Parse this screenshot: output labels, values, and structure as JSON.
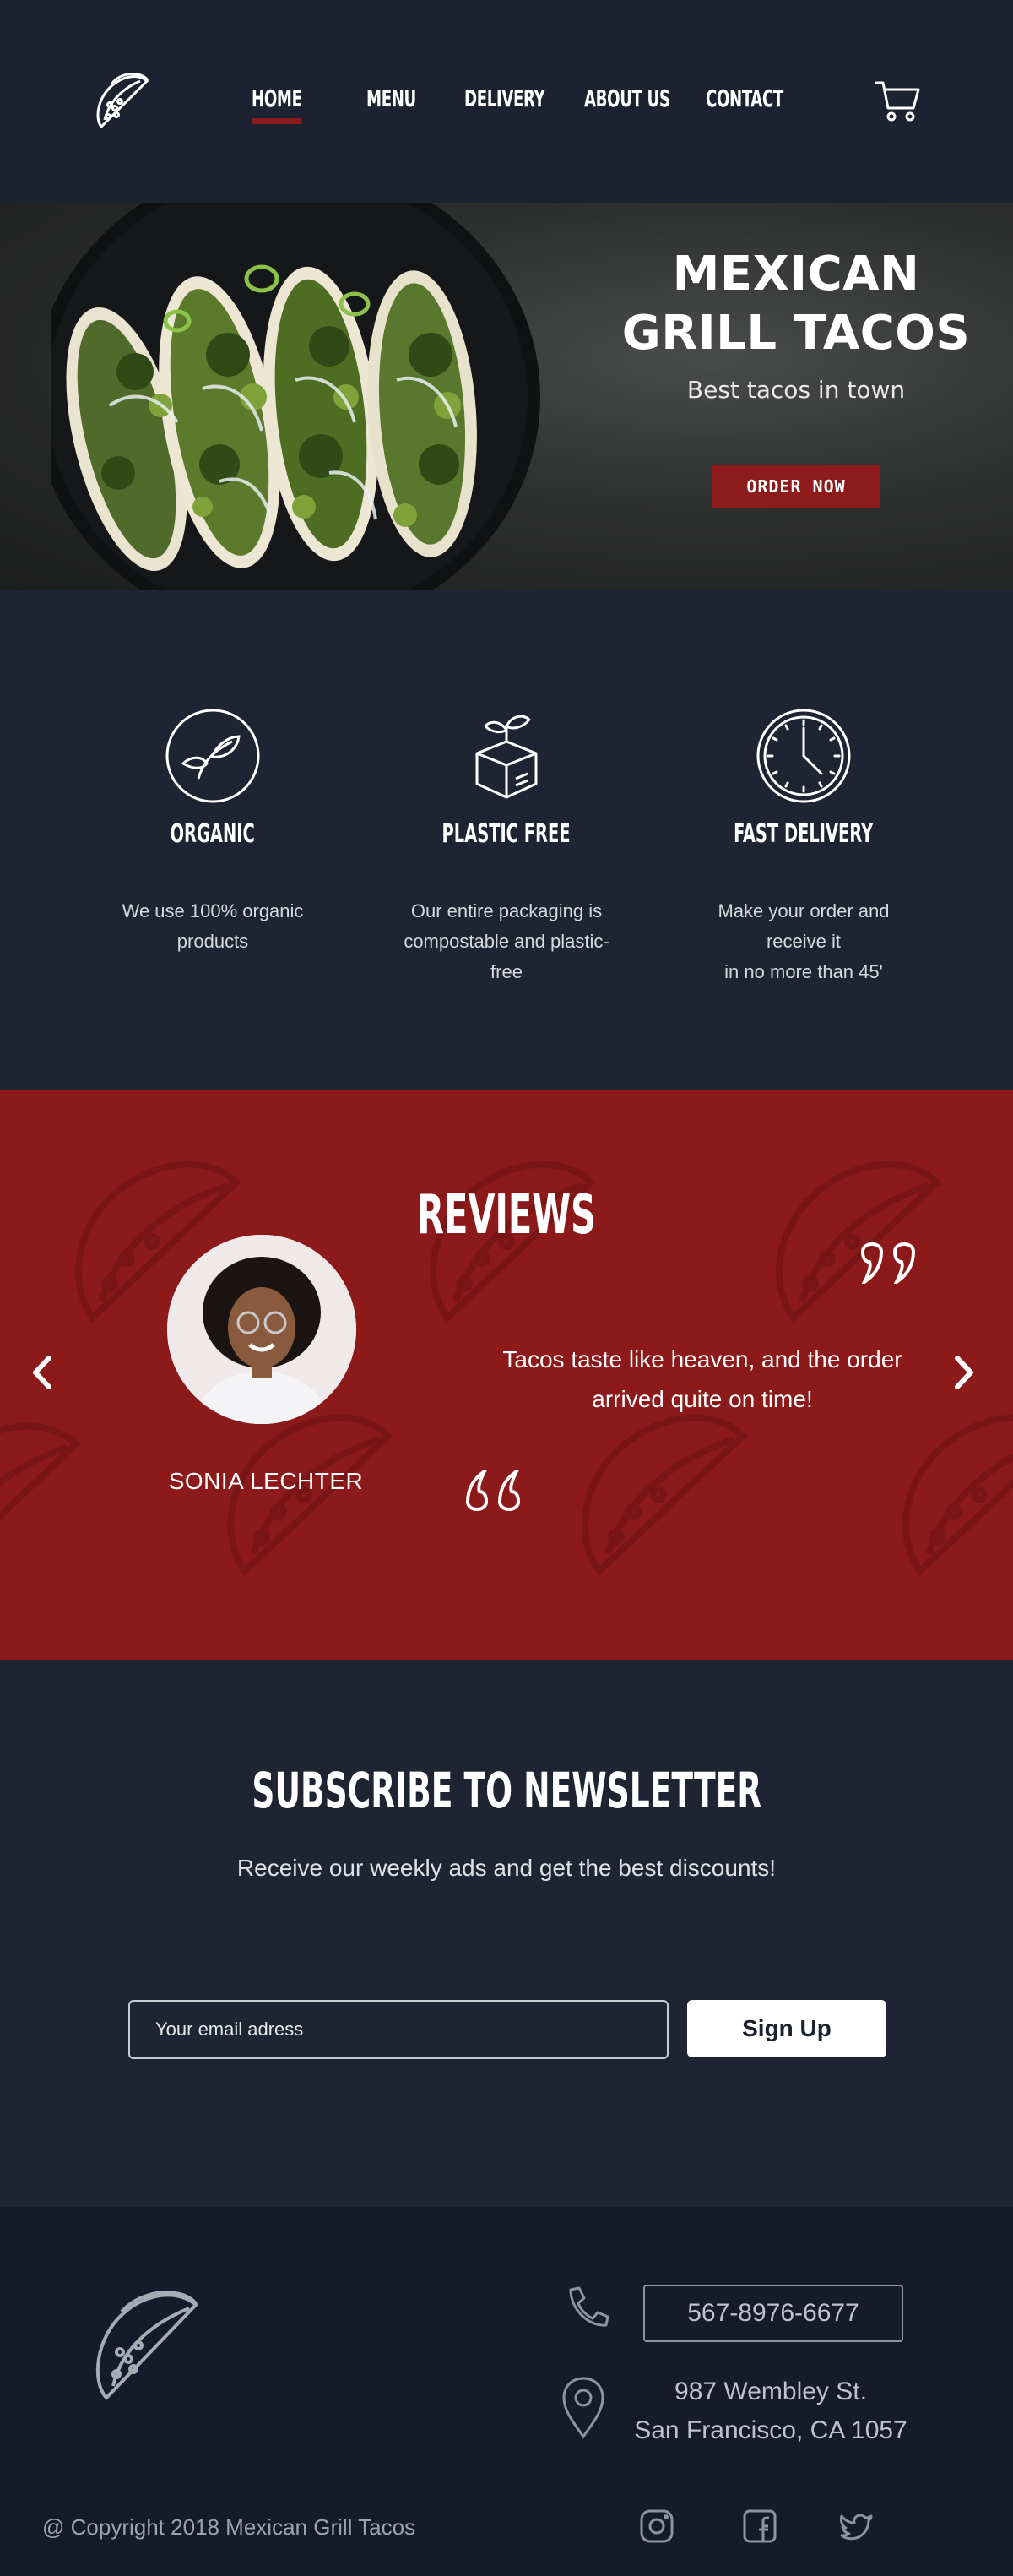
{
  "header": {
    "nav": [
      {
        "label": "HOME",
        "active": true
      },
      {
        "label": "MENU",
        "active": false
      },
      {
        "label": "DELIVERY",
        "active": false
      },
      {
        "label": "ABOUT US",
        "active": false
      },
      {
        "label": "CONTACT",
        "active": false
      }
    ],
    "icons": [
      "taco-logo-icon",
      "shopping-cart-icon"
    ]
  },
  "hero": {
    "title_line1": "MEXICAN",
    "title_line2": "GRILL TACOS",
    "subtitle": "Best tacos in town",
    "cta": "ORDER NOW"
  },
  "features": [
    {
      "icon": "leaf-icon",
      "title": "ORGANIC",
      "text_line1": "We use 100% organic",
      "text_line2": "products"
    },
    {
      "icon": "eco-box-icon",
      "title": "PLASTIC FREE",
      "text_line1": "Our entire packaging is",
      "text_line2": "compostable and plastic-free"
    },
    {
      "icon": "clock-icon",
      "title": "FAST DELIVERY",
      "text_line1": "Make your order and receive it",
      "text_line2": "in no more than 45'"
    }
  ],
  "reviews": {
    "title": "REVIEWS",
    "reviewer": "SONIA LECHTER",
    "text": "Tacos taste like heaven, and the order arrived quite on time!"
  },
  "newsletter": {
    "title": "SUBSCRIBE TO NEWSLETTER",
    "subtitle": "Receive our weekly ads and get the best discounts!",
    "placeholder": "Your email adress",
    "button": "Sign Up"
  },
  "footer": {
    "phone": "567-8976-6677",
    "address_line1": "987 Wembley St.",
    "address_line2": "San Francisco, CA 1057",
    "copyright": "@ Copyright 2018 Mexican Grill Tacos",
    "social": [
      "instagram-icon",
      "facebook-icon",
      "twitter-icon"
    ]
  },
  "colors": {
    "brand_red": "#8c1a1a",
    "navy": "#1f2433",
    "footer_navy": "#161a2b"
  }
}
